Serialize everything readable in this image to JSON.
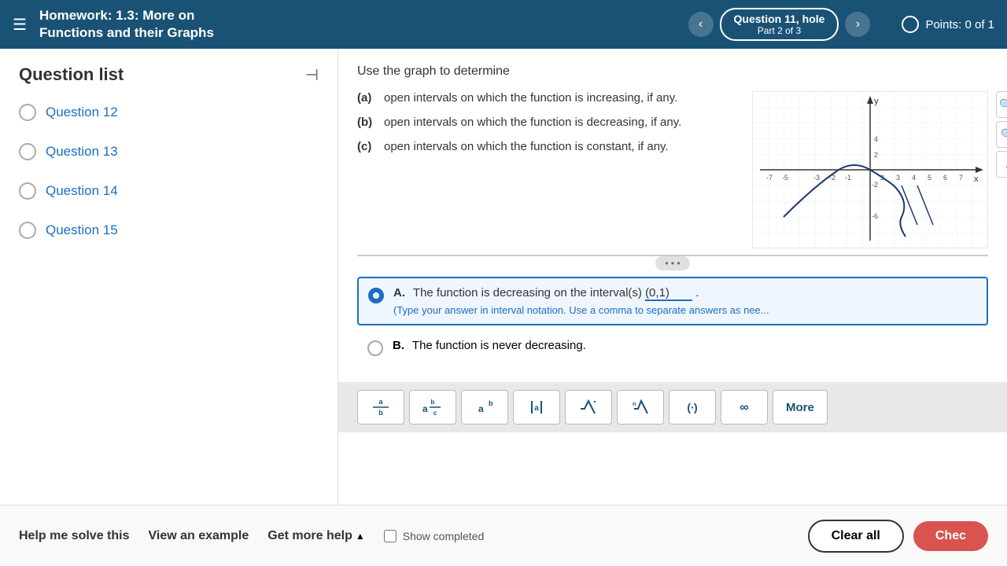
{
  "header": {
    "menu_icon": "☰",
    "title_line1": "Homework: ",
    "title_bold": "1.3: More on",
    "title_line2": "Functions and their Graphs",
    "nav_prev": "‹",
    "nav_next": "›",
    "nav_label": "Question 11, hole",
    "nav_sublabel": "Part 2 of 3",
    "points_label": "Points: 0 of 1"
  },
  "sidebar": {
    "title": "Question list",
    "collapse_icon": "⊣",
    "questions": [
      {
        "label": "Question 12"
      },
      {
        "label": "Question 13"
      },
      {
        "label": "Question 14"
      },
      {
        "label": "Question 15"
      }
    ]
  },
  "question": {
    "prompt": "Use the graph to determine",
    "parts": [
      {
        "label": "(a)",
        "text": "open intervals on which the function is increasing, if any."
      },
      {
        "label": "(b)",
        "text": "open intervals on which the function is decreasing, if any."
      },
      {
        "label": "(c)",
        "text": "open intervals on which the function is constant, if any."
      }
    ]
  },
  "answer_options": [
    {
      "id": "A",
      "selected": true,
      "text_prefix": "The function is decreasing on the interval(s) ",
      "input_value": "(0,1)",
      "text_suffix": ".",
      "hint": "(Type your answer in interval notation. Use a comma to separate answers as nee..."
    },
    {
      "id": "B",
      "selected": false,
      "text": "The function is never decreasing."
    }
  ],
  "math_toolbar": {
    "buttons": [
      {
        "label": "⊣",
        "title": "fraction"
      },
      {
        "label": "⊢⊣",
        "title": "mixed-number"
      },
      {
        "label": "⌐¬",
        "title": "superscript"
      },
      {
        "label": "▐▌",
        "title": "absolute-value"
      },
      {
        "label": "√",
        "title": "sqrt"
      },
      {
        "label": "∜",
        "title": "nth-root"
      },
      {
        "label": "(…)",
        "title": "parentheses"
      },
      {
        "label": "∞",
        "title": "infinity"
      }
    ],
    "more_label": "More"
  },
  "footer": {
    "help_link": "Help me solve this",
    "example_link": "View an example",
    "more_help_link": "Get more help",
    "more_help_icon": "▲",
    "clear_label": "Clear all",
    "check_label": "Chec",
    "show_completed_label": "Show completed"
  },
  "dots": "• • •"
}
